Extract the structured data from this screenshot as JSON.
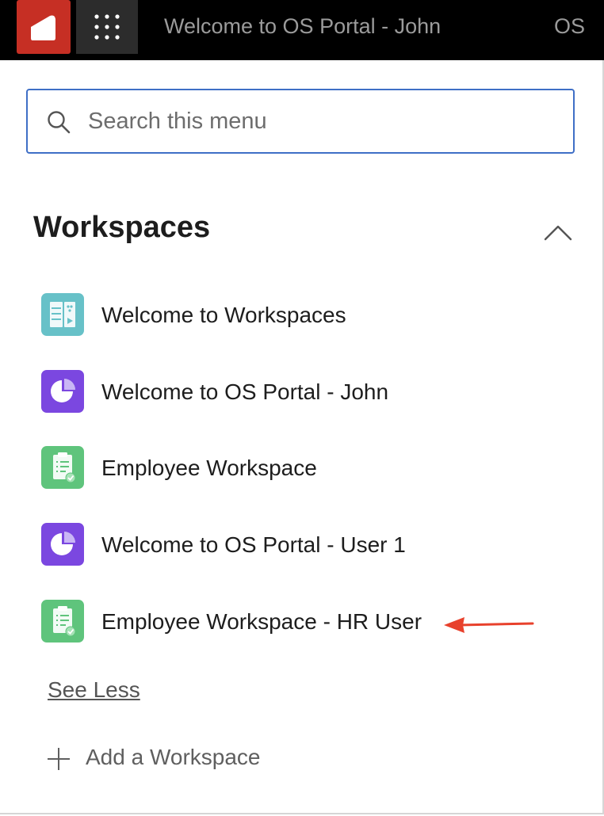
{
  "topbar": {
    "title": "Welcome to OS Portal - John",
    "initials": "OS",
    "logo_icon": "portal-logo-icon",
    "apps_icon": "app-launcher-grid-icon",
    "logo_color": "#c62f24"
  },
  "search": {
    "placeholder": "Search this menu",
    "value": "",
    "icon": "search-icon",
    "border_color": "#3f6fc6"
  },
  "workspaces": {
    "title": "Workspaces",
    "collapse_icon": "chevron-up-icon",
    "items": [
      {
        "label": "Welcome to Workspaces",
        "icon": "workspace-layout-icon",
        "color": "#67c1c8"
      },
      {
        "label": "Welcome to OS Portal - John",
        "icon": "pie-chart-icon",
        "color": "#7b47e0"
      },
      {
        "label": "Employee Workspace",
        "icon": "clipboard-check-icon",
        "color": "#5fc47c"
      },
      {
        "label": "Welcome to OS Portal - User 1",
        "icon": "pie-chart-icon",
        "color": "#7b47e0"
      },
      {
        "label": "Employee Workspace - HR User",
        "icon": "clipboard-check-icon",
        "color": "#5fc47c"
      }
    ],
    "see_less": "See Less",
    "add_label": "Add a Workspace",
    "add_icon": "plus-icon"
  },
  "annotation": {
    "icon": "red-arrow-icon",
    "color": "#e8412c"
  }
}
